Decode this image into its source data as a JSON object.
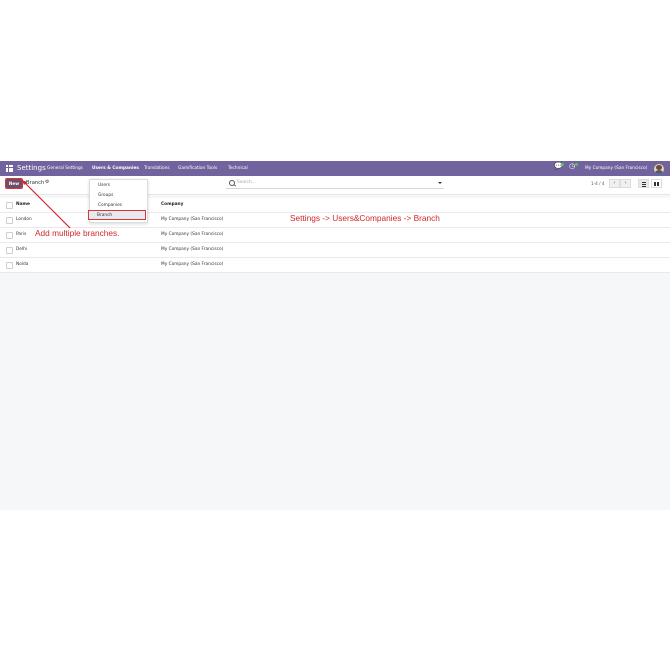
{
  "navbar": {
    "app_title": "Settings",
    "menus": [
      "General Settings",
      "Users & Companies",
      "Translations",
      "Gamification Tools",
      "Technical"
    ],
    "active_menu": "Users & Companies",
    "company": "My Company (San Francisco)"
  },
  "control_panel": {
    "new_label": "New",
    "breadcrumb": "Branch",
    "gear": "⚙",
    "search_placeholder": "Search...",
    "pager": "1-4 / 4",
    "prev": "‹",
    "next": "›"
  },
  "dropdown": {
    "items": [
      "Users",
      "Groups",
      "Companies",
      "Branch"
    ],
    "selected": "Branch"
  },
  "table": {
    "headers": {
      "name": "Name",
      "company": "Company"
    },
    "rows": [
      {
        "name": "London",
        "company": "My Company (San Francisco)"
      },
      {
        "name": "Paris",
        "company": "My Company (San Francisco)"
      },
      {
        "name": "Delhi",
        "company": "My Company (San Francisco)"
      },
      {
        "name": "Noida",
        "company": "My Company (San Francisco)"
      }
    ]
  },
  "annotations": {
    "path": "Settings -> Users&Companies -> Branch",
    "add_note": "Add multiple branches."
  },
  "colors": {
    "navbar": "#71639e",
    "primary": "#714b67",
    "annotation": "#d0272d"
  }
}
